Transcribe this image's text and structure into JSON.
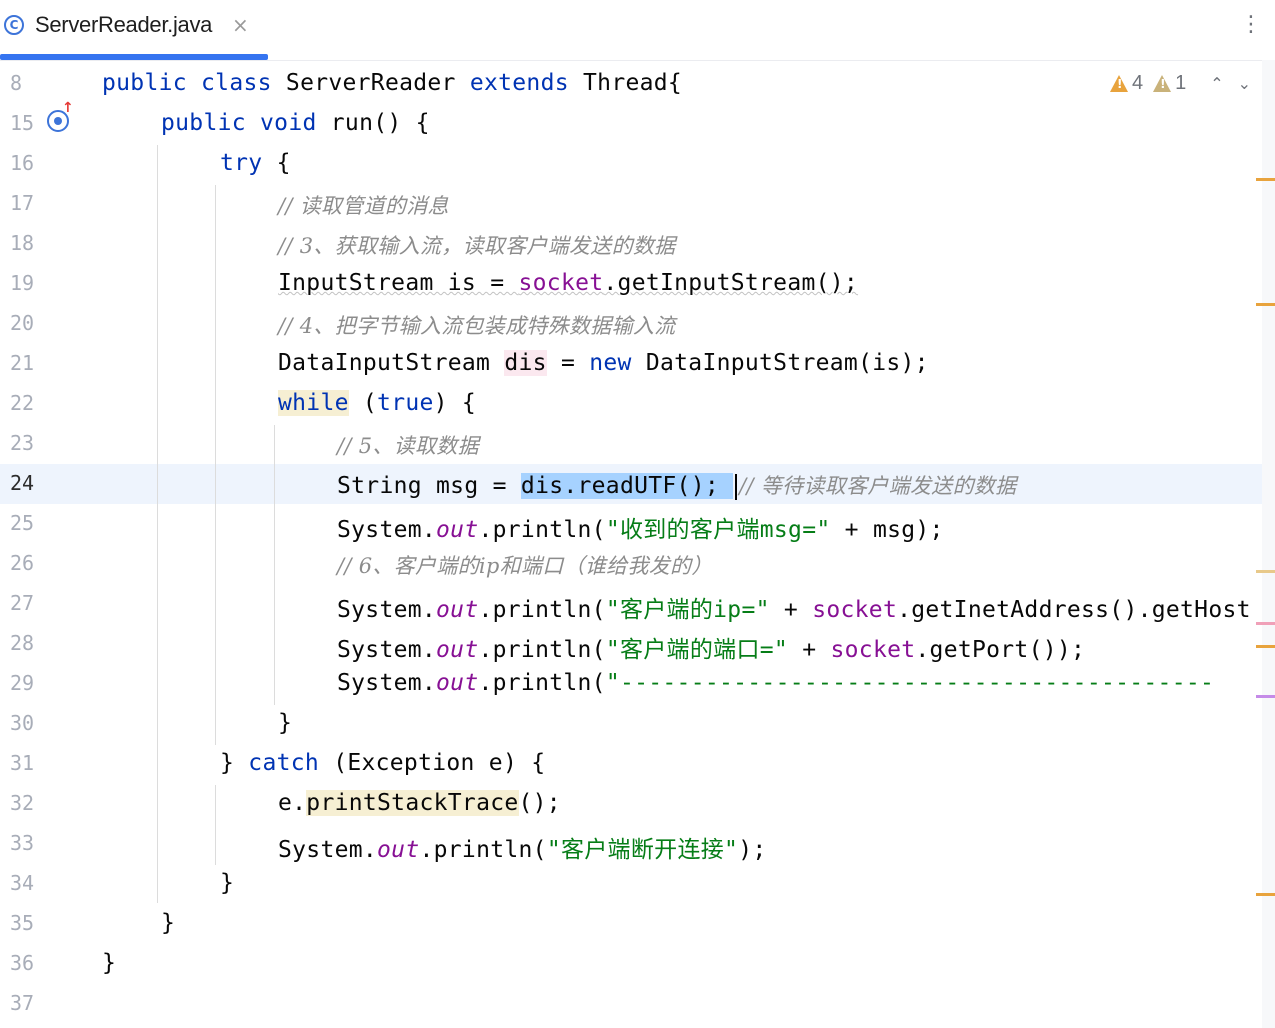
{
  "tab": {
    "icon": "C",
    "title": "ServerReader.java",
    "close": "×"
  },
  "toolbar": {
    "more": "⋮"
  },
  "inspections": {
    "warnings": "4",
    "weak_warnings": "1",
    "prev": "⌃",
    "next": "⌄"
  },
  "code_lines": [
    {
      "n": "8",
      "tokens": [
        [
          "kw",
          "public "
        ],
        [
          "kw",
          "class "
        ],
        [
          "",
          "ServerReader "
        ],
        [
          "kw",
          "extends "
        ],
        [
          "",
          "Thread{"
        ]
      ]
    },
    {
      "n": "15",
      "tokens": [
        [
          "kw",
          "public "
        ],
        [
          "kw",
          "void "
        ],
        [
          "kw2",
          "run"
        ],
        [
          "",
          "() {"
        ]
      ]
    },
    {
      "n": "16",
      "tokens": [
        [
          "kw",
          "try "
        ],
        [
          "",
          "{"
        ]
      ]
    },
    {
      "n": "17",
      "tokens": [
        [
          "cmt",
          "// 读取管道的消息"
        ]
      ]
    },
    {
      "n": "18",
      "tokens": [
        [
          "cmt",
          "// 3、获取输入流，读取客户端发送的数据"
        ]
      ]
    },
    {
      "n": "19",
      "tokens": [
        [
          "wavy",
          "InputStream is = "
        ],
        [
          "fldw",
          "socket"
        ],
        [
          "wavy",
          ".getInputStream();"
        ]
      ]
    },
    {
      "n": "20",
      "tokens": [
        [
          "cmt",
          "// 4、把字节输入流包装成特殊数据输入流"
        ]
      ]
    },
    {
      "n": "21",
      "tokens": [
        [
          "",
          "DataInputStream "
        ],
        [
          "pink",
          "dis"
        ],
        [
          "",
          " = "
        ],
        [
          "kw",
          "new "
        ],
        [
          "",
          "DataInputStream(is);"
        ]
      ]
    },
    {
      "n": "22",
      "tokens": [
        [
          "kwwarn",
          "while"
        ],
        [
          "",
          " ("
        ],
        [
          "kw",
          "true"
        ],
        [
          "",
          ") {"
        ]
      ]
    },
    {
      "n": "23",
      "tokens": [
        [
          "cmt",
          "// 5、读取数据"
        ]
      ]
    },
    {
      "n": "24",
      "tokens": [
        [
          "",
          "String msg = "
        ],
        [
          "sel",
          "dis.readUTF(); "
        ],
        [
          "caret",
          ""
        ],
        [
          "cmt",
          "// 等待读取客户端发送的数据"
        ]
      ]
    },
    {
      "n": "25",
      "tokens": [
        [
          "",
          "System."
        ],
        [
          "static",
          "out"
        ],
        [
          "",
          ".println("
        ],
        [
          "str",
          "\"收到的客户端msg=\""
        ],
        [
          "",
          " + msg);"
        ]
      ]
    },
    {
      "n": "26",
      "tokens": [
        [
          "cmt",
          "// 6、客户端的ip和端口（谁给我发的）"
        ]
      ]
    },
    {
      "n": "27",
      "tokens": [
        [
          "",
          "System."
        ],
        [
          "static",
          "out"
        ],
        [
          "",
          ".println("
        ],
        [
          "str",
          "\"客户端的ip=\""
        ],
        [
          "",
          " + "
        ],
        [
          "fld",
          "socket"
        ],
        [
          "",
          ".getInetAddress().getHost"
        ]
      ]
    },
    {
      "n": "28",
      "tokens": [
        [
          "",
          "System."
        ],
        [
          "static",
          "out"
        ],
        [
          "",
          ".println("
        ],
        [
          "str",
          "\"客户端的端口=\""
        ],
        [
          "",
          " + "
        ],
        [
          "fld",
          "socket"
        ],
        [
          "",
          ".getPort());"
        ]
      ]
    },
    {
      "n": "29",
      "tokens": [
        [
          "",
          "System."
        ],
        [
          "static",
          "out"
        ],
        [
          "",
          ".println("
        ],
        [
          "str",
          "\"------------------------------------------"
        ]
      ]
    },
    {
      "n": "30",
      "tokens": [
        [
          "",
          "}"
        ]
      ]
    },
    {
      "n": "31",
      "tokens": [
        [
          "",
          "} "
        ],
        [
          "kw",
          "catch "
        ],
        [
          "",
          "(Exception e) {"
        ]
      ]
    },
    {
      "n": "32",
      "tokens": [
        [
          "",
          "e."
        ],
        [
          "warnbg",
          "printStackTrace"
        ],
        [
          "",
          "();"
        ]
      ]
    },
    {
      "n": "33",
      "tokens": [
        [
          "",
          "System."
        ],
        [
          "static",
          "out"
        ],
        [
          "",
          ".println("
        ],
        [
          "str",
          "\"客户端断开连接\""
        ],
        [
          "",
          ");"
        ]
      ]
    },
    {
      "n": "34",
      "tokens": [
        [
          "",
          "}"
        ]
      ]
    },
    {
      "n": "35",
      "tokens": [
        [
          "",
          "}"
        ]
      ]
    },
    {
      "n": "36",
      "tokens": [
        [
          "",
          "}"
        ]
      ]
    },
    {
      "n": "37",
      "tokens": []
    }
  ],
  "colors": {
    "keyword": "#0033b3",
    "string": "#067d17",
    "field": "#871094",
    "comment": "#8c8c8c",
    "selection": "#a6d2ff",
    "current_line": "#eef4fd"
  }
}
